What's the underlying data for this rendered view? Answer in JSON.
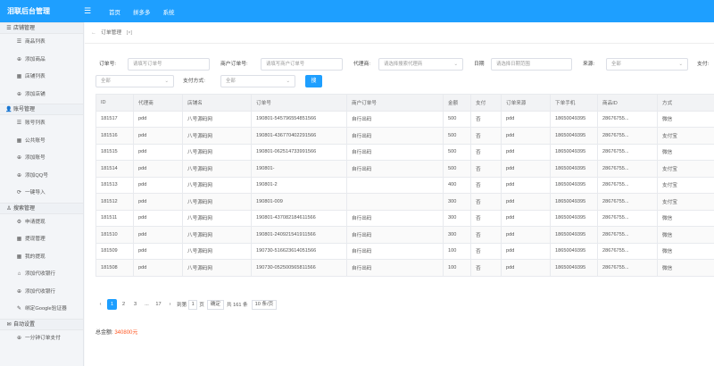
{
  "app": {
    "title": "泪联后台管理",
    "menu_icon": "menu-icon"
  },
  "topnav": [
    "首页",
    "拼多多",
    "系统"
  ],
  "sidebar": {
    "groups": [
      {
        "icon": "list-icon",
        "title": "店铺管理",
        "items": [
          {
            "icon": "list-icon",
            "label": "商品列表"
          },
          {
            "icon": "circle-plus-icon",
            "label": "添加商品"
          },
          {
            "icon": "grid-icon",
            "label": "店铺列表"
          },
          {
            "icon": "circle-plus-icon",
            "label": "添加店铺"
          }
        ]
      },
      {
        "icon": "user-icon",
        "title": "账号管理",
        "items": [
          {
            "icon": "list-icon",
            "label": "账号列表"
          },
          {
            "icon": "grid-icon",
            "label": "公共账号"
          },
          {
            "icon": "circle-plus-icon",
            "label": "添加账号"
          },
          {
            "icon": "circle-plus-icon",
            "label": "添加QQ号"
          },
          {
            "icon": "refresh-icon",
            "label": "一键导入"
          }
        ]
      },
      {
        "icon": "person-icon",
        "title": "搜索管理",
        "items": [
          {
            "icon": "gear-icon",
            "label": "申请提现"
          },
          {
            "icon": "grid-icon",
            "label": "提现管理"
          },
          {
            "icon": "grid-icon",
            "label": "我的提现"
          },
          {
            "icon": "home-icon",
            "label": "添加代收银行"
          },
          {
            "icon": "circle-plus-icon",
            "label": "添加代收银行"
          },
          {
            "icon": "pin-icon",
            "label": "绑定Google验证器"
          }
        ]
      },
      {
        "icon": "chat-icon",
        "title": "自动设置",
        "items": [
          {
            "icon": "circle-plus-icon",
            "label": "一分钟订单支付"
          }
        ]
      }
    ]
  },
  "breadcrumb": {
    "arrow": "←",
    "label": "订单管理",
    "close": "[×]"
  },
  "filters": {
    "order_no": {
      "label": "订单号:",
      "placeholder": "请填写订单号"
    },
    "merchant_order_no": {
      "label": "商户订单号:",
      "placeholder": "请填写商户订单号"
    },
    "agent": {
      "label": "代理商:",
      "value": "请选择搜索代理商"
    },
    "date": {
      "label": "日期",
      "placeholder": "请选择日期范围"
    },
    "source": {
      "label": "来源:",
      "value": "全部"
    },
    "pay": {
      "label": "支付:",
      "value": "全部"
    },
    "pay_method": {
      "label": "支付方式:",
      "value": "全部"
    },
    "search_label": "搜"
  },
  "table": {
    "columns": [
      "ID",
      "代理商",
      "店铺名",
      "订单号",
      "商户订单号",
      "金额",
      "支付",
      "订单来源",
      "下单手机",
      "商品ID",
      "方式"
    ],
    "rows": [
      [
        "181517",
        "pdd",
        "八号源码网",
        "190801-545796554851566",
        "自行出码",
        "500",
        "否",
        "pdd",
        "18650049395",
        "28676755...",
        "微信"
      ],
      [
        "181516",
        "pdd",
        "八号源码网",
        "190801-436770402291566",
        "自行出码",
        "500",
        "否",
        "pdd",
        "18650049395",
        "28676755...",
        "支付宝"
      ],
      [
        "181515",
        "pdd",
        "八号源码网",
        "190801-062514733991566",
        "自行出码",
        "500",
        "否",
        "pdd",
        "18650049395",
        "28676755...",
        "微信"
      ],
      [
        "181514",
        "pdd",
        "八号源码网",
        "190801-",
        "自行出码",
        "500",
        "否",
        "pdd",
        "18650049395",
        "28676755...",
        "支付宝"
      ],
      [
        "181513",
        "pdd",
        "八号源码网",
        "190801-2",
        "",
        "400",
        "否",
        "pdd",
        "18650049395",
        "28676755...",
        "支付宝"
      ],
      [
        "181512",
        "pdd",
        "八号源码网",
        "190801-009",
        "",
        "300",
        "否",
        "pdd",
        "18650049395",
        "28676755...",
        "支付宝"
      ],
      [
        "181511",
        "pdd",
        "八号源码网",
        "190801-437082184611566",
        "自行出码",
        "300",
        "否",
        "pdd",
        "18650049395",
        "28676755...",
        "微信"
      ],
      [
        "181510",
        "pdd",
        "八号源码网",
        "190801-240921541911566",
        "自行出码",
        "300",
        "否",
        "pdd",
        "18650049395",
        "28676755...",
        "微信"
      ],
      [
        "181509",
        "pdd",
        "八号源码网",
        "190730-516623614051566",
        "自行出码",
        "100",
        "否",
        "pdd",
        "18650049395",
        "28676755...",
        "微信"
      ],
      [
        "181508",
        "pdd",
        "八号源码网",
        "190730-052500565811566",
        "自行出码",
        "100",
        "否",
        "pdd",
        "18650049395",
        "28676755...",
        "微信"
      ]
    ]
  },
  "pager": {
    "prev": "‹",
    "pages": [
      "1",
      "2",
      "3"
    ],
    "ellipsis": "...",
    "last": "17",
    "next": "›",
    "goto_label": "到第",
    "goto_value": "1",
    "page_unit": "页",
    "confirm": "确定",
    "total": "共 161 条",
    "page_size": "10 条/页"
  },
  "summary": {
    "label": "总金额:",
    "amount": "340800元"
  }
}
